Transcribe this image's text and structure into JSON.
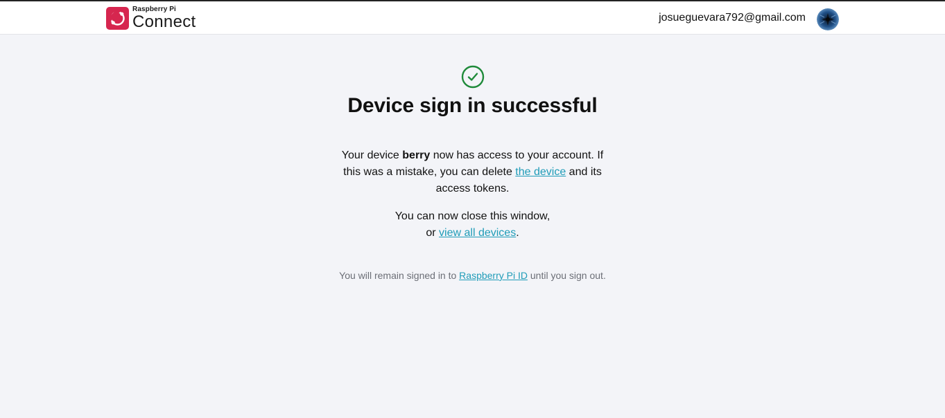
{
  "header": {
    "brand_small": "Raspberry Pi",
    "brand_big": "Connect",
    "user_email": "josueguevara792@gmail.com",
    "avatar_icon": "user-avatar"
  },
  "main": {
    "status_icon": "check-circle-icon",
    "title": "Device sign in successful",
    "p1_before": "Your device ",
    "p1_device": "berry",
    "p1_middle": " now has access to your account. If this was a mistake, you can delete ",
    "p1_link": "the device",
    "p1_after": " and its access tokens.",
    "p2_line1": "You can now close this window,",
    "p2_before": "or ",
    "p2_link": "view all devices",
    "p2_after": ".",
    "note_before": "You will remain signed in to ",
    "note_link": "Raspberry Pi ID",
    "note_after": " until you sign out."
  },
  "colors": {
    "brand_red": "#d6264f",
    "success_green": "#1f8a3a",
    "link": "#1f9cb8",
    "background": "#f3f4f8"
  }
}
